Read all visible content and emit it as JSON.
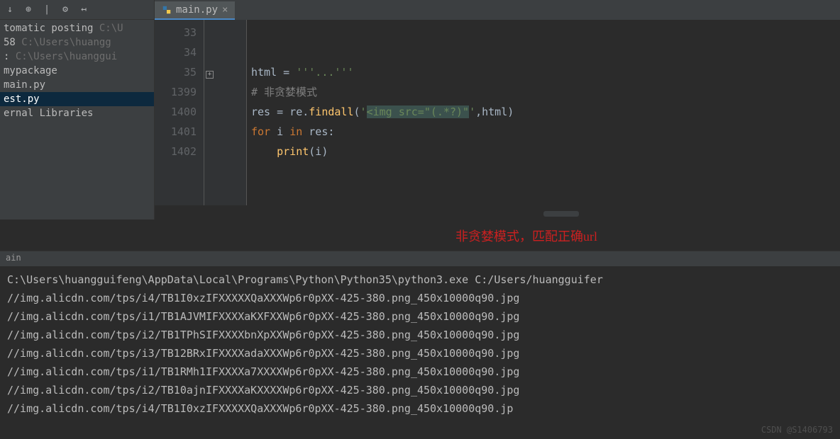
{
  "toolbar": {
    "icons": [
      "arrow-down",
      "target",
      "gear",
      "collapse"
    ]
  },
  "tree": {
    "items": [
      {
        "label": "tomatic posting",
        "path": "C:\\U",
        "selected": false
      },
      {
        "label": "58",
        "path": "C:\\Users\\huangg",
        "selected": false
      },
      {
        "label": ":",
        "path": "C:\\Users\\huanggui",
        "selected": false
      },
      {
        "label": "mypackage",
        "path": "",
        "selected": false
      },
      {
        "label": "main.py",
        "path": "",
        "selected": false
      },
      {
        "label": "est.py",
        "path": "",
        "selected": true
      },
      {
        "label": "ernal Libraries",
        "path": "",
        "selected": false
      }
    ]
  },
  "tab": {
    "filename": "main.py",
    "icon": "python-file-icon"
  },
  "code": {
    "lines": [
      {
        "num": "33",
        "content": ""
      },
      {
        "num": "34",
        "content": ""
      },
      {
        "num": "35",
        "fold": true,
        "tokens": [
          {
            "t": "op",
            "v": "html = "
          },
          {
            "t": "string",
            "v": "'''...'''"
          }
        ]
      },
      {
        "num": "1399",
        "tokens": [
          {
            "t": "comment",
            "v": "# 非贪婪模式"
          }
        ]
      },
      {
        "num": "1400",
        "tokens": [
          {
            "t": "op",
            "v": "res = re."
          },
          {
            "t": "func",
            "v": "findall"
          },
          {
            "t": "op",
            "v": "("
          },
          {
            "t": "string",
            "v": "'"
          },
          {
            "t": "regex",
            "v": "<img src=\"(.*?)\""
          },
          {
            "t": "string",
            "v": "'"
          },
          {
            "t": "op",
            "v": ",html)"
          }
        ]
      },
      {
        "num": "1401",
        "tokens": [
          {
            "t": "keyword",
            "v": "for "
          },
          {
            "t": "op",
            "v": "i "
          },
          {
            "t": "keyword",
            "v": "in "
          },
          {
            "t": "op",
            "v": "res:"
          }
        ]
      },
      {
        "num": "1402",
        "tokens": [
          {
            "t": "op",
            "v": "    "
          },
          {
            "t": "func",
            "v": "print"
          },
          {
            "t": "op",
            "v": "(i)"
          }
        ]
      }
    ]
  },
  "annotation": "非贪婪模式，匹配正确url",
  "status": {
    "text": "ain"
  },
  "console": {
    "lines": [
      "C:\\Users\\huangguifeng\\AppData\\Local\\Programs\\Python\\Python35\\python3.exe C:/Users/huangguifer",
      "//img.alicdn.com/tps/i4/TB1I0xzIFXXXXXQaXXXWp6r0pXX-425-380.png_450x10000q90.jpg",
      "//img.alicdn.com/tps/i1/TB1AJVMIFXXXXaKXFXXWp6r0pXX-425-380.png_450x10000q90.jpg",
      "//img.alicdn.com/tps/i2/TB1TPhSIFXXXXbnXpXXWp6r0pXX-425-380.png_450x10000q90.jpg",
      "//img.alicdn.com/tps/i3/TB12BRxIFXXXXadaXXXWp6r0pXX-425-380.png_450x10000q90.jpg",
      "//img.alicdn.com/tps/i1/TB1RMh1IFXXXXa7XXXXWp6r0pXX-425-380.png_450x10000q90.jpg",
      "//img.alicdn.com/tps/i2/TB10ajnIFXXXXaKXXXXWp6r0pXX-425-380.png_450x10000q90.jpg",
      "//img.alicdn.com/tps/i4/TB1I0xzIFXXXXXQaXXXWp6r0pXX-425-380.png_450x10000q90.jp"
    ]
  },
  "watermark": "CSDN @S1406793"
}
